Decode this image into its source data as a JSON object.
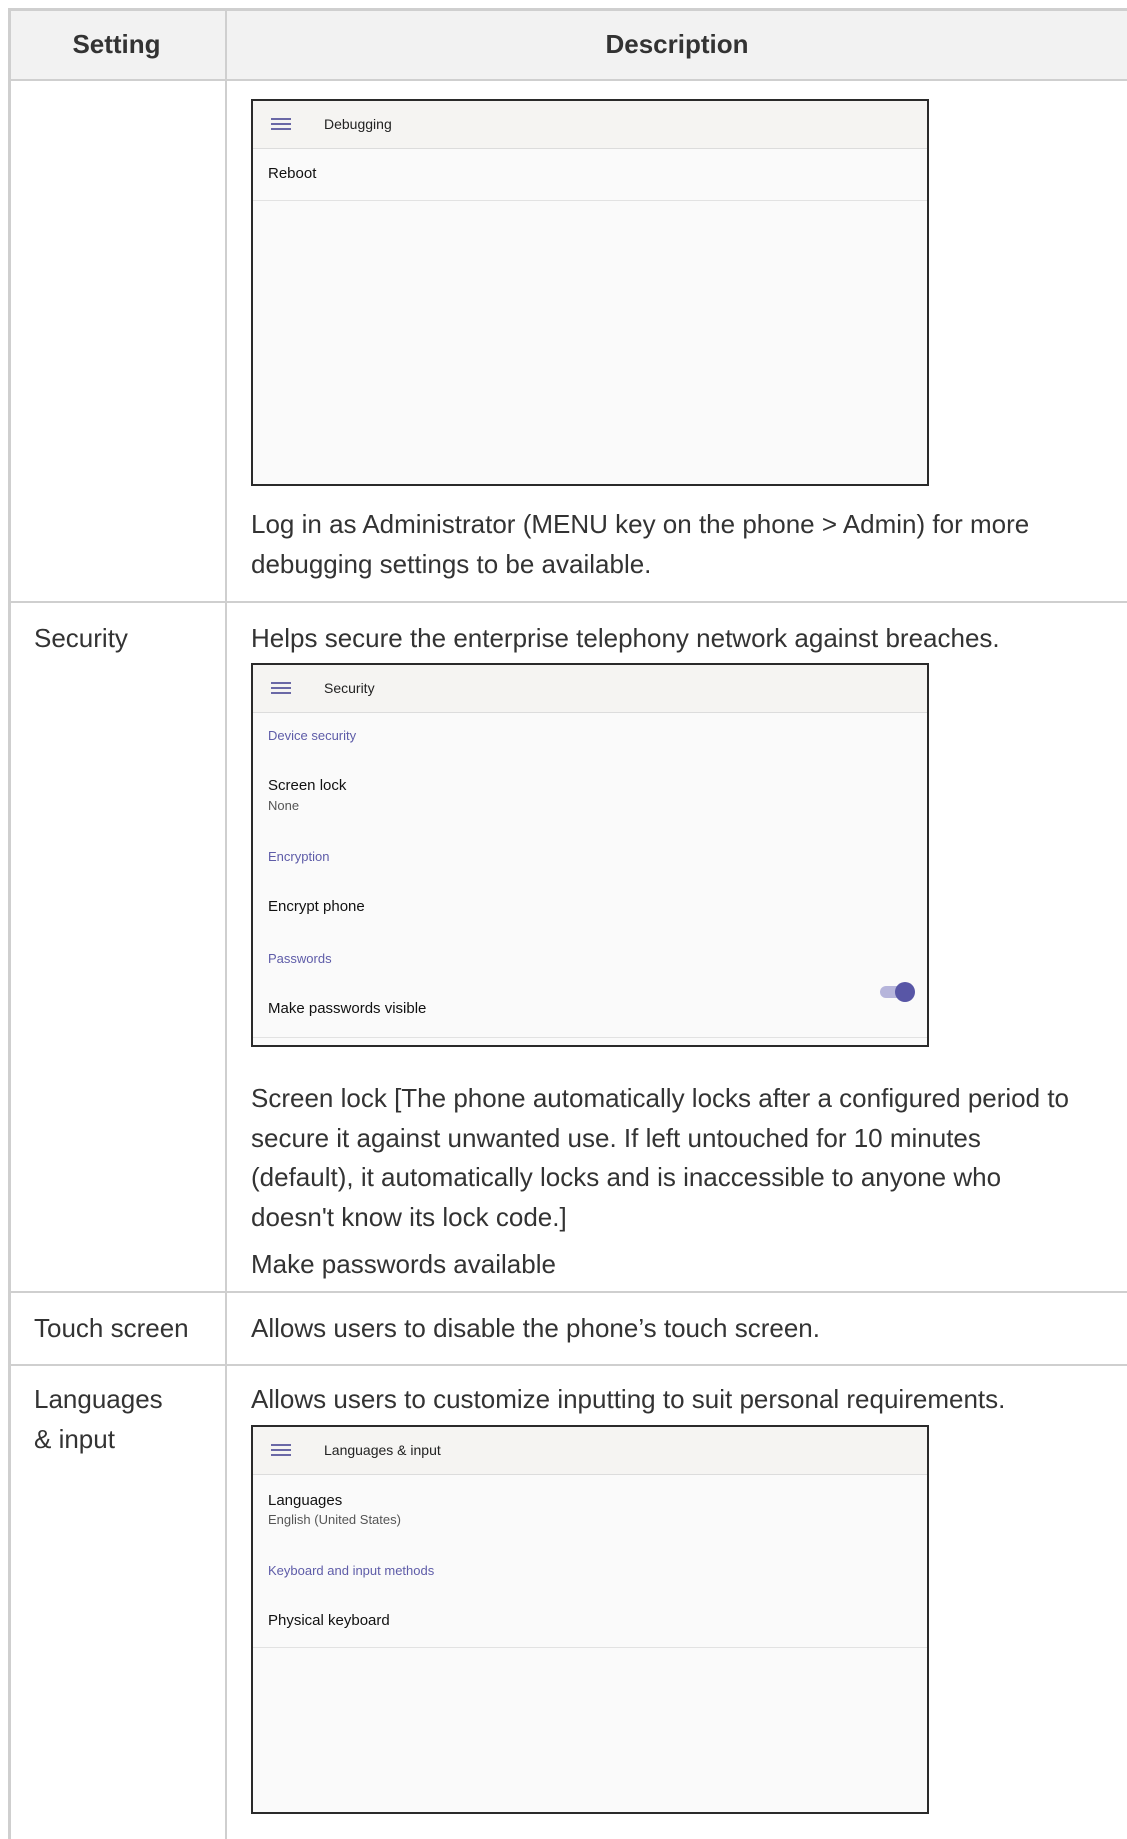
{
  "table": {
    "header": {
      "setting": "Setting",
      "description": "Description"
    },
    "rows": [
      {
        "setting": "",
        "screen": {
          "title": "Debugging",
          "items": [
            "Reboot"
          ]
        },
        "note": [
          "Log in as Administrator (MENU key on the phone > Admin) for more",
          "debugging settings to be available."
        ]
      },
      {
        "setting": "Security",
        "intro": "Helps secure the enterprise telephony network against breaches.",
        "screen": {
          "title": "Security",
          "cat_device": "Device security",
          "screen_lock": "Screen lock",
          "screen_lock_value": "None",
          "cat_encryption": "Encryption",
          "encrypt_phone": "Encrypt phone",
          "cat_passwords": "Passwords",
          "make_visible": "Make passwords visible",
          "make_visible_on": true
        },
        "note": [
          "Screen lock [The phone automatically locks after a configured period to",
          "secure it against unwanted use. If left untouched for 10 minutes",
          "(default), it automatically locks and is inaccessible to anyone who",
          "doesn't know its lock code.]",
          "Make passwords available"
        ]
      },
      {
        "setting": "Touch screen",
        "intro": "Allows users to disable the phone’s touch screen."
      },
      {
        "setting": [
          "Languages",
          "& input"
        ],
        "intro": "Allows users to customize inputting to suit personal requirements.",
        "screen": {
          "title": "Languages & input",
          "languages": "Languages",
          "languages_value": "English (United States)",
          "cat_keyboard": "Keyboard and input methods",
          "physical_keyboard": "Physical keyboard"
        }
      }
    ]
  },
  "colors": {
    "accent": "#5e5ca8",
    "border": "#cfcfcf",
    "header_bg": "#f2f2f2"
  }
}
